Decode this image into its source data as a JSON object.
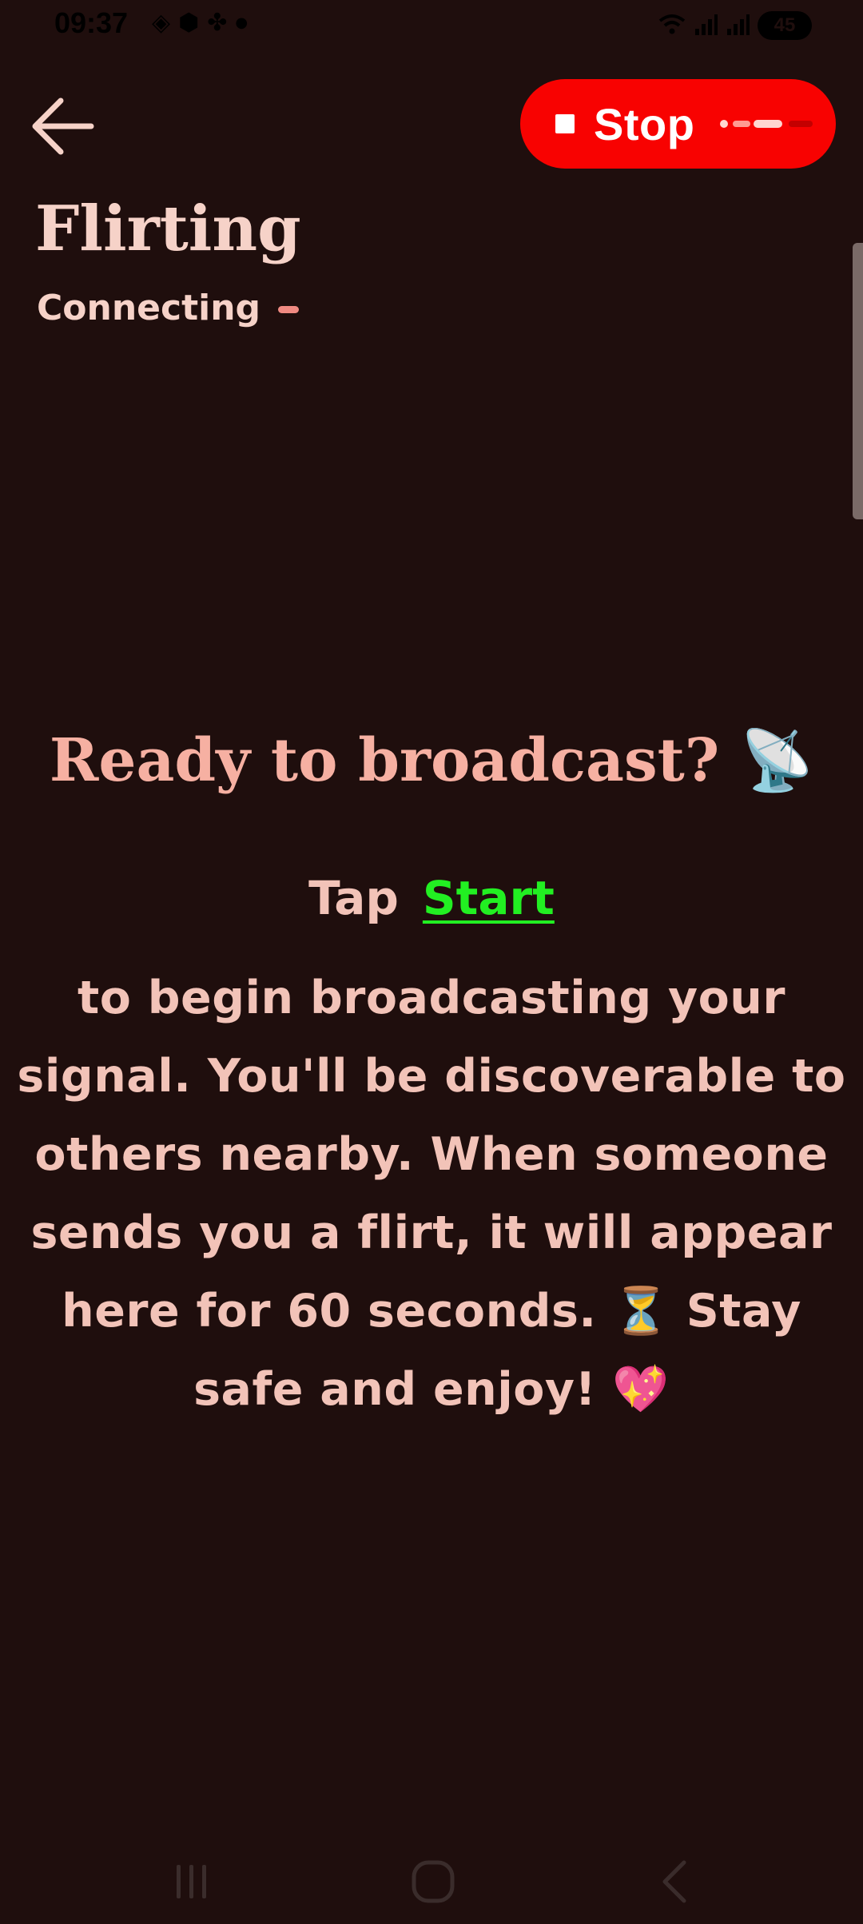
{
  "status_bar": {
    "time": "09:37",
    "left_icons": [
      "notification-diamond-icon",
      "notification-shield-icon",
      "notification-fan-icon",
      "dot-icon"
    ],
    "right_icons": [
      "wifi-icon",
      "signal-icon",
      "signal-icon"
    ],
    "battery": "45"
  },
  "header": {
    "title": "Flirting",
    "status": "Connecting",
    "stop_label": "Stop"
  },
  "main": {
    "headline": "Ready to broadcast? 📡",
    "tap_prefix": "Tap",
    "start_label": "Start",
    "description": "to begin broadcasting your signal. You'll be discoverable to others nearby. When someone sends you a flirt, it will appear here for 60 seconds. ⏳ Stay safe and enjoy! 💖"
  },
  "colors": {
    "background": "#1f0e0d",
    "stop_button": "#f80201",
    "start_link": "#22ef22",
    "headline": "#f6b0a2",
    "text": "#f2c3b8"
  }
}
